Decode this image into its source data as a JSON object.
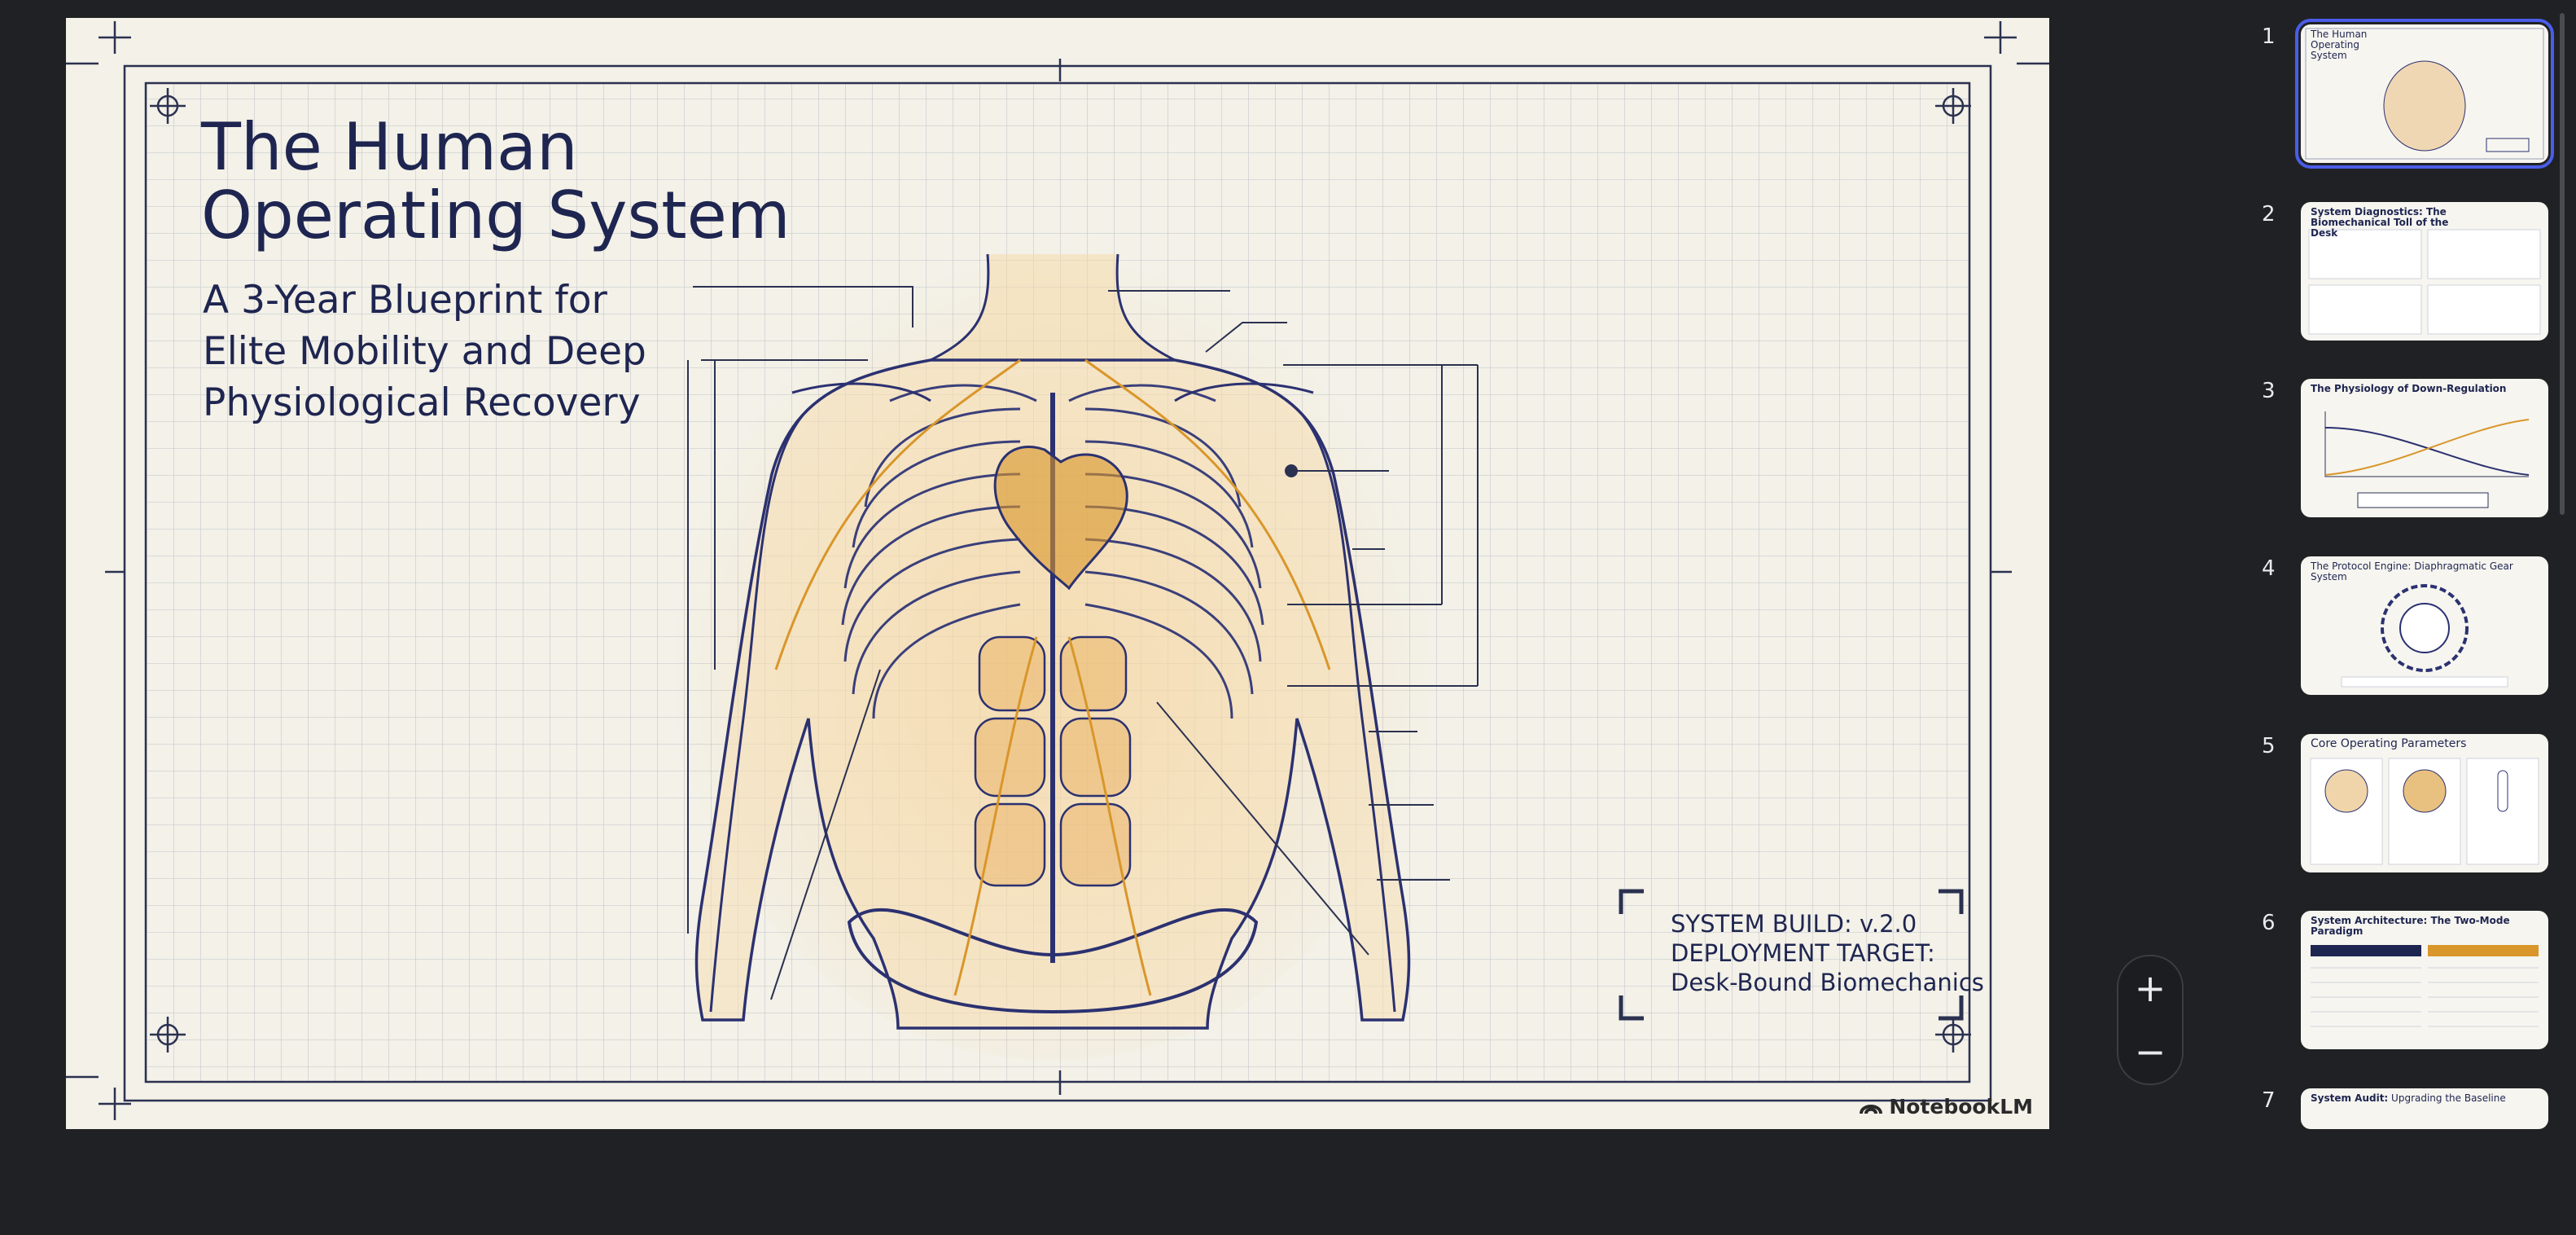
{
  "slide": {
    "title_line1": "The Human",
    "title_line2": "Operating System",
    "subtitle_line1": "A 3-Year Blueprint for",
    "subtitle_line2": "Elite Mobility and Deep",
    "subtitle_line3": "Physiological Recovery",
    "build_line1": "SYSTEM BUILD: v.2.0",
    "build_line2": "DEPLOYMENT TARGET:",
    "build_line3": "Desk-Bound Biomechanics",
    "brand": "NotebookLM",
    "illustration": "anatomical-torso-blueprint"
  },
  "zoom": {
    "in_icon": "plus-icon",
    "out_icon": "minus-icon",
    "in_label": "+",
    "out_label": "−"
  },
  "thumbnails": [
    {
      "number": "1",
      "title": "The Human Operating System",
      "active": true
    },
    {
      "number": "2",
      "title": "System Diagnostics: The Biomechanical Toll of the Desk"
    },
    {
      "number": "3",
      "title": "The Physiology of Down-Regulation"
    },
    {
      "number": "4",
      "title": "The Protocol Engine: Diaphragmatic Gear System"
    },
    {
      "number": "5",
      "title": "Core Operating Parameters"
    },
    {
      "number": "6",
      "title": "System Architecture: The Two-Mode Paradigm"
    },
    {
      "number": "7",
      "title_accent": "System Audit:",
      "title_rest": " Upgrading the Baseline"
    }
  ],
  "colors": {
    "ink": "#1e2550",
    "accent": "#d9962a",
    "selection": "#4a5de8",
    "panel_bg": "#202124"
  }
}
